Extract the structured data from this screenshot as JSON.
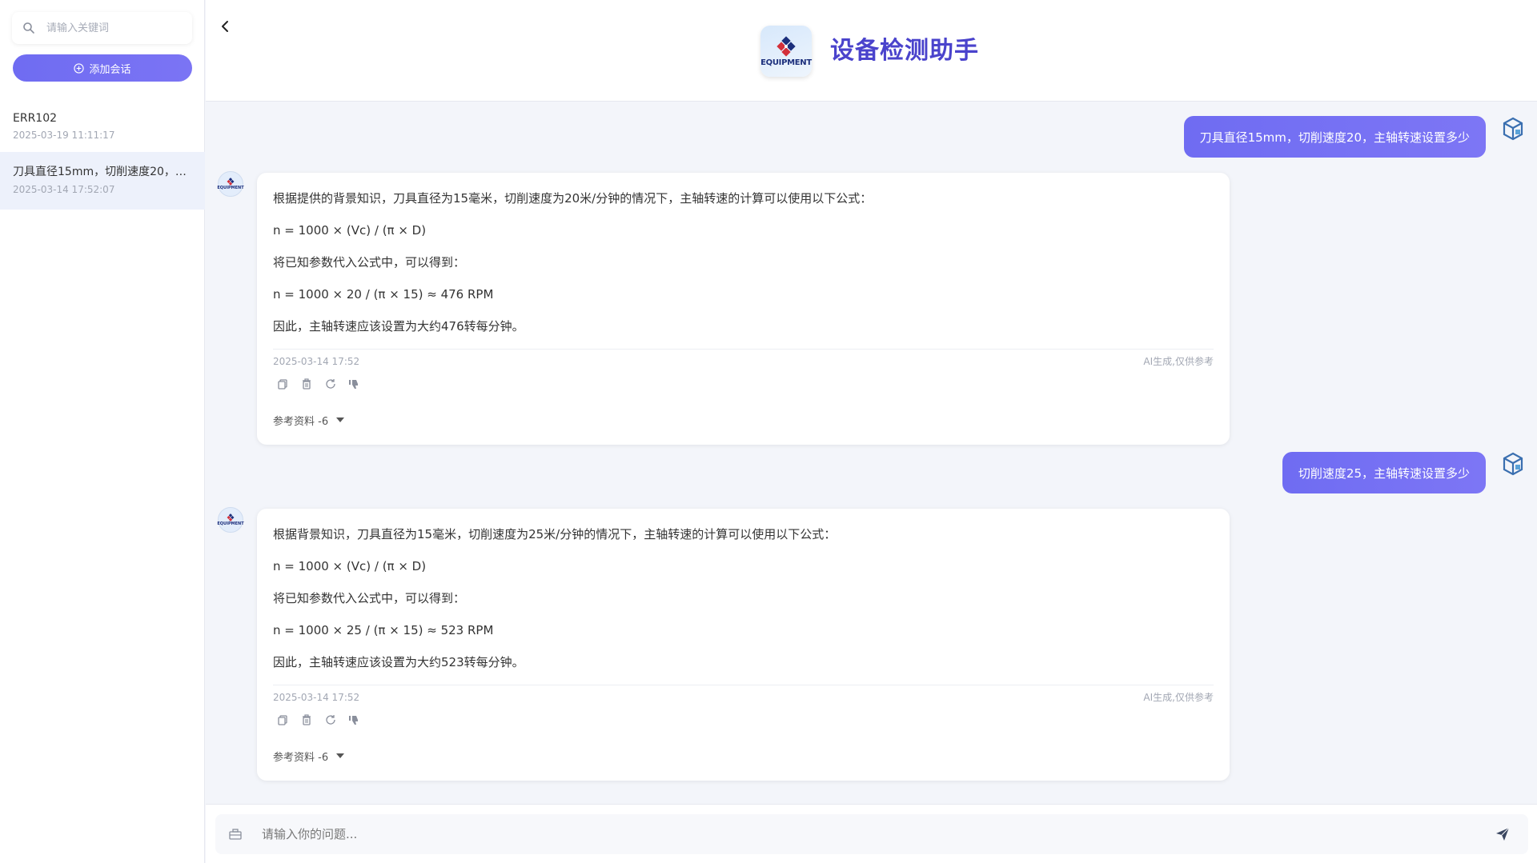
{
  "sidebar": {
    "search_placeholder": "请输入关键词",
    "add_label": "添加会话",
    "conversations": [
      {
        "title": "ERR102",
        "time": "2025-03-19 11:11:17"
      },
      {
        "title": "刀具直径15mm，切削速度20，主轴转速设置多少",
        "time": "2025-03-14 17:52:07"
      }
    ]
  },
  "header": {
    "logo_text": "EQUIPMENT",
    "title": "设备检测助手"
  },
  "messages": [
    {
      "role": "user",
      "text": "刀具直径15mm，切削速度20，主轴转速设置多少"
    },
    {
      "role": "bot",
      "lines": [
        "根据提供的背景知识，刀具直径为15毫米，切削速度为20米/分钟的情况下，主轴转速的计算可以使用以下公式：",
        "n = 1000 × (Vc) / (π × D)",
        "将已知参数代入公式中，可以得到：",
        "n = 1000 × 20 / (π × 15) ≈ 476 RPM",
        "因此，主轴转速应该设置为大约476转每分钟。"
      ],
      "time": "2025-03-14 17:52",
      "disclaimer": "AI生成,仅供参考",
      "refs": "参考资料 -6"
    },
    {
      "role": "user",
      "text": "切削速度25，主轴转速设置多少"
    },
    {
      "role": "bot",
      "lines": [
        "根据背景知识，刀具直径为15毫米，切削速度为25米/分钟的情况下，主轴转速的计算可以使用以下公式：",
        "n = 1000 × (Vc) / (π × D)",
        "将已知参数代入公式中，可以得到：",
        "n = 1000 × 25 / (π × 15) ≈ 523 RPM",
        "因此，主轴转速应该设置为大约523转每分钟。"
      ],
      "time": "2025-03-14 17:52",
      "disclaimer": "AI生成,仅供参考",
      "refs": "参考资料 -6"
    }
  ],
  "input": {
    "placeholder": "请输入你的问题..."
  },
  "colors": {
    "accent": "#6f6cf2",
    "title": "#4a43cc"
  },
  "icons": [
    "search-icon",
    "plus-circle-icon",
    "chevron-left-icon",
    "copy-icon",
    "delete-icon",
    "refresh-icon",
    "thumbs-down-icon",
    "caret-down-icon",
    "toolbox-icon",
    "send-icon"
  ]
}
